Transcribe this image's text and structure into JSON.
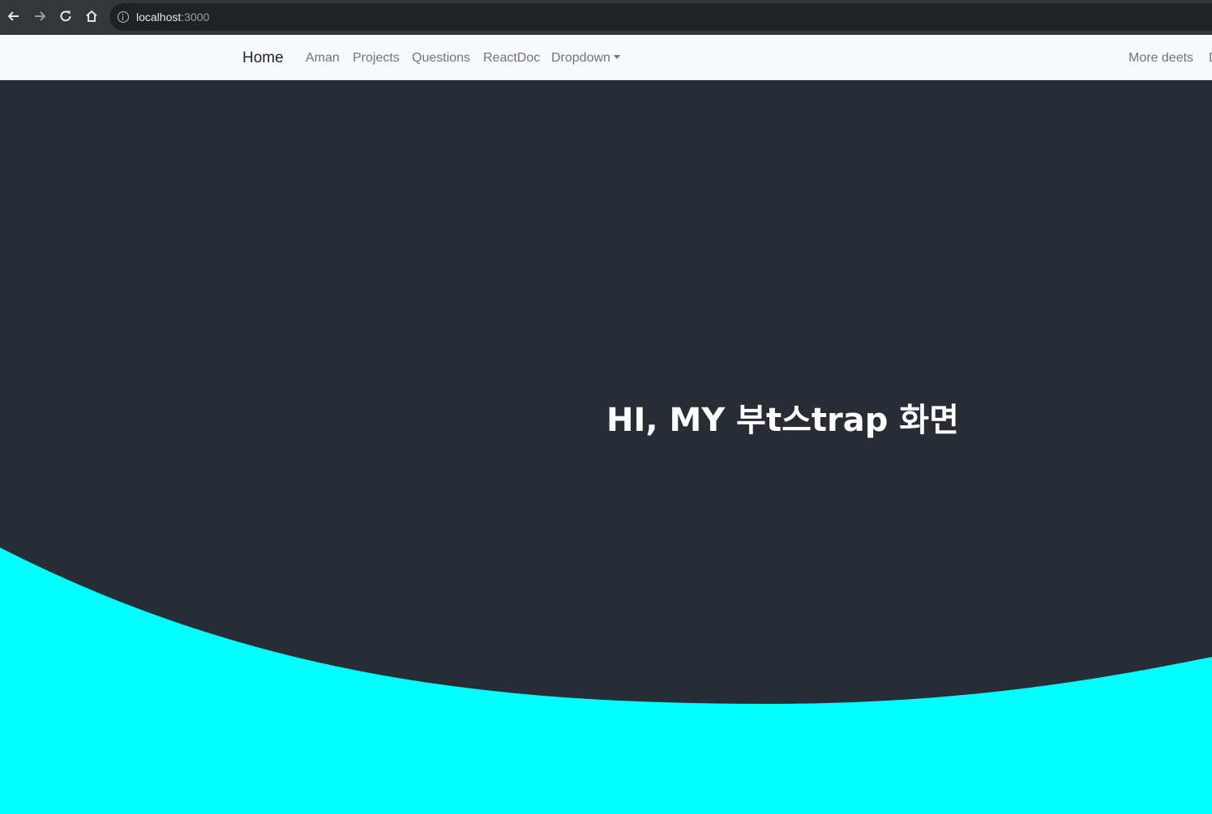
{
  "browser": {
    "url_host": "localhost",
    "url_port": ":3000",
    "icons": [
      "back-arrow-icon",
      "forward-arrow-icon",
      "reload-icon",
      "home-icon",
      "info-icon"
    ]
  },
  "navbar": {
    "brand": "Home",
    "links": [
      "Aman",
      "Projects",
      "Questions",
      "ReactDoc"
    ],
    "dropdown_label": "Dropdown",
    "right_link": "More deets",
    "cut_link": "D"
  },
  "hero": {
    "title": "HI, MY 부t스trap 화면"
  },
  "colors": {
    "hero_bg": "#282c34",
    "wave": "#00ffff",
    "navbar_bg": "#f8f9fa"
  }
}
